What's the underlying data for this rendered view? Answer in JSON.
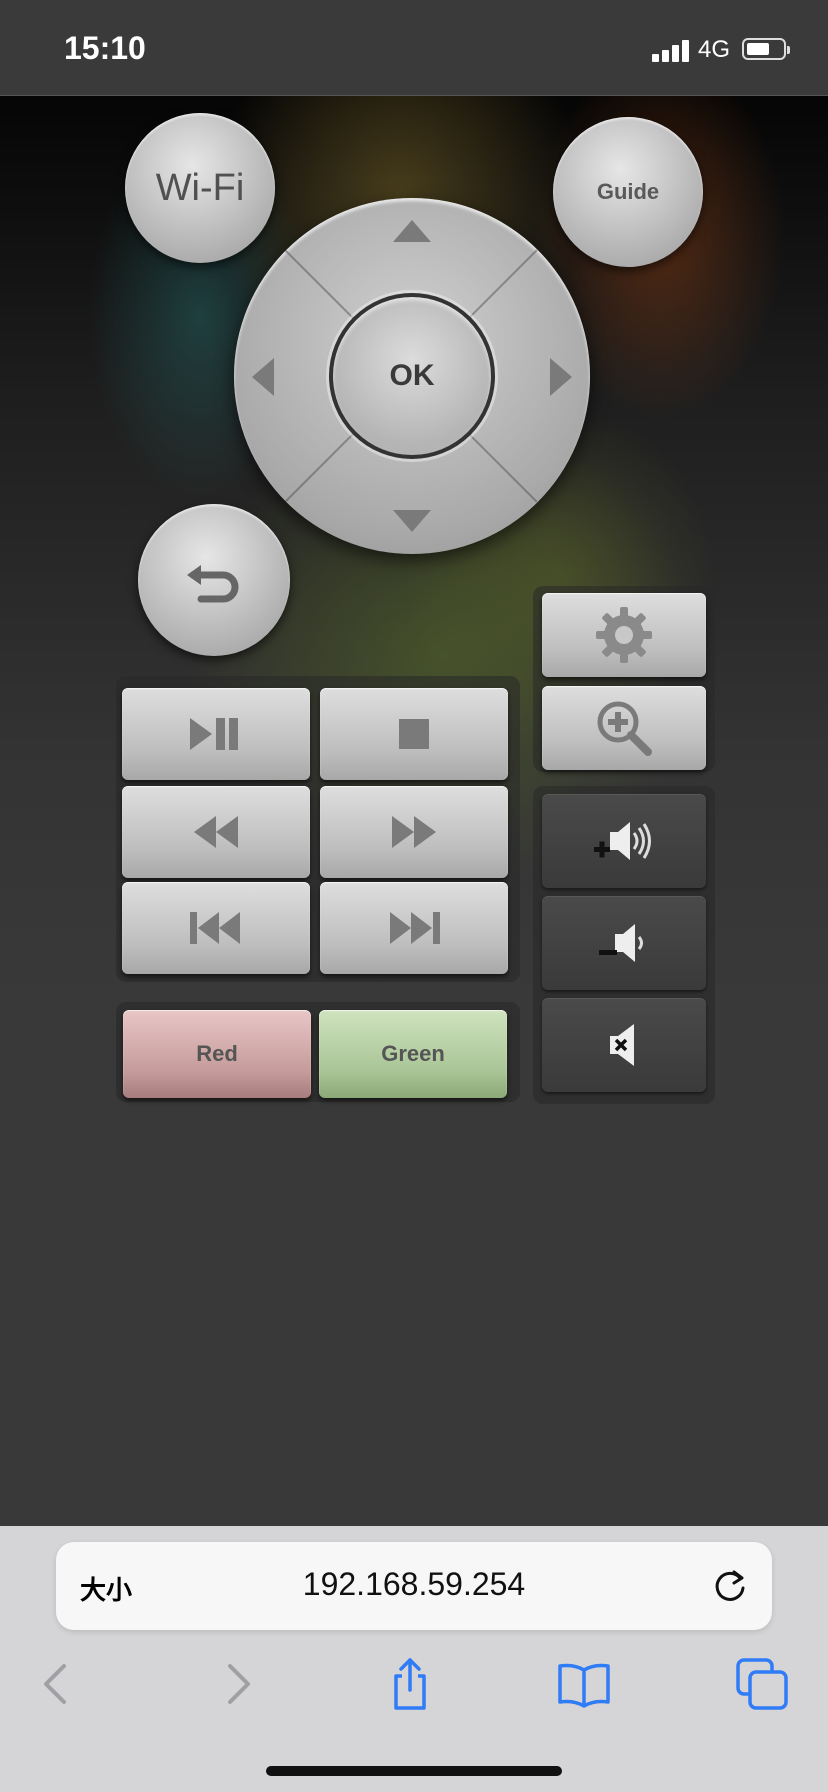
{
  "status_bar": {
    "time": "15:10",
    "network": "4G",
    "icons": [
      "signal-icon",
      "battery-icon"
    ]
  },
  "remote": {
    "wifi_label": "Wi-Fi",
    "guide_label": "Guide",
    "ok_label": "OK",
    "red_label": "Red",
    "green_label": "Green",
    "icons": {
      "back": "back-arrow-icon",
      "play_pause": "play-pause-icon",
      "stop": "stop-icon",
      "rewind": "rewind-icon",
      "fast_forward": "fast-forward-icon",
      "previous": "skip-previous-icon",
      "next": "skip-next-icon",
      "settings": "gear-icon",
      "zoom": "zoom-in-icon",
      "volume_up": "volume-up-icon",
      "volume_down": "volume-down-icon",
      "mute": "mute-icon"
    },
    "colors": {
      "red_button": "#c59b9b",
      "green_button": "#a9c596"
    }
  },
  "browser": {
    "text_size_label": "大小",
    "url": "192.168.59.254",
    "icons": [
      "reload-icon",
      "back-icon",
      "forward-icon",
      "share-icon",
      "bookmarks-icon",
      "tabs-icon"
    ]
  }
}
